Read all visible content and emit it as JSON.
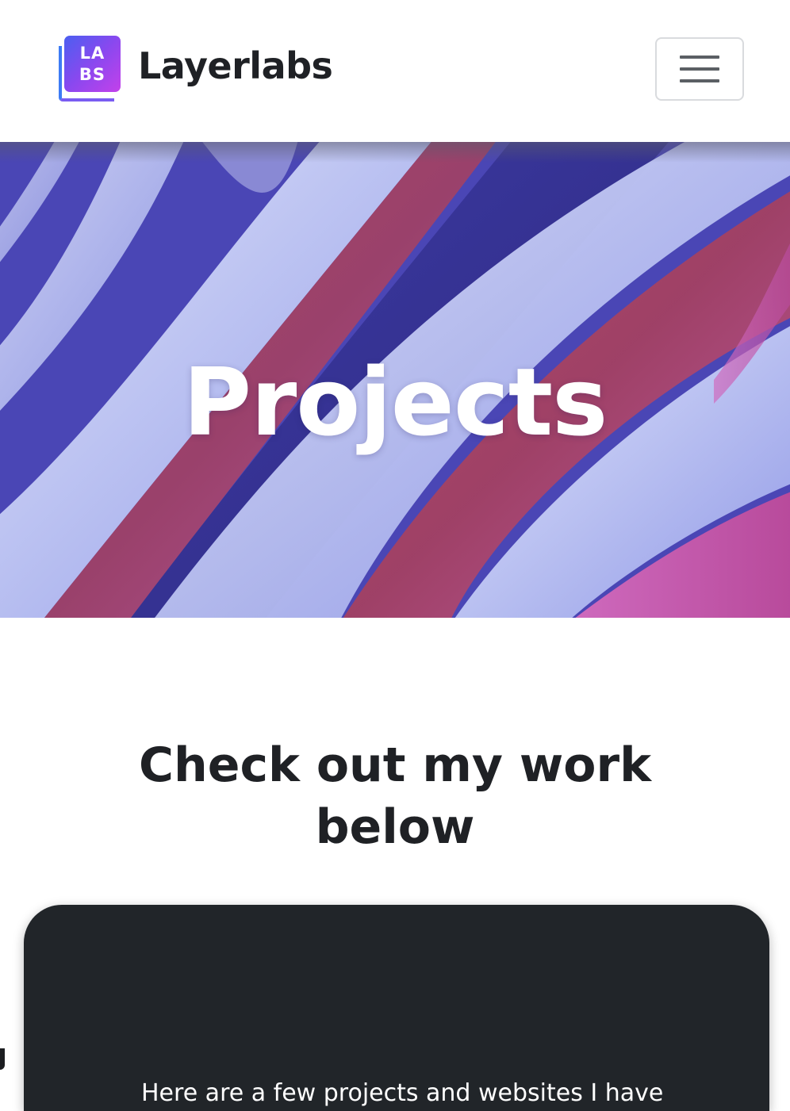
{
  "navbar": {
    "logo_line1": "LA",
    "logo_line2": "BS",
    "brand_name": "Layerlabs",
    "menu_icon": "hamburger-menu-icon"
  },
  "hero": {
    "title": "Projects"
  },
  "section": {
    "heading": "Check out my work below"
  },
  "card": {
    "text": "Here are a few projects and websites I have"
  },
  "colors": {
    "text_dark": "#1f2125",
    "card_bg": "#212529",
    "logo_gradient_start": "#4b5ff0",
    "logo_gradient_end": "#c341ea"
  }
}
